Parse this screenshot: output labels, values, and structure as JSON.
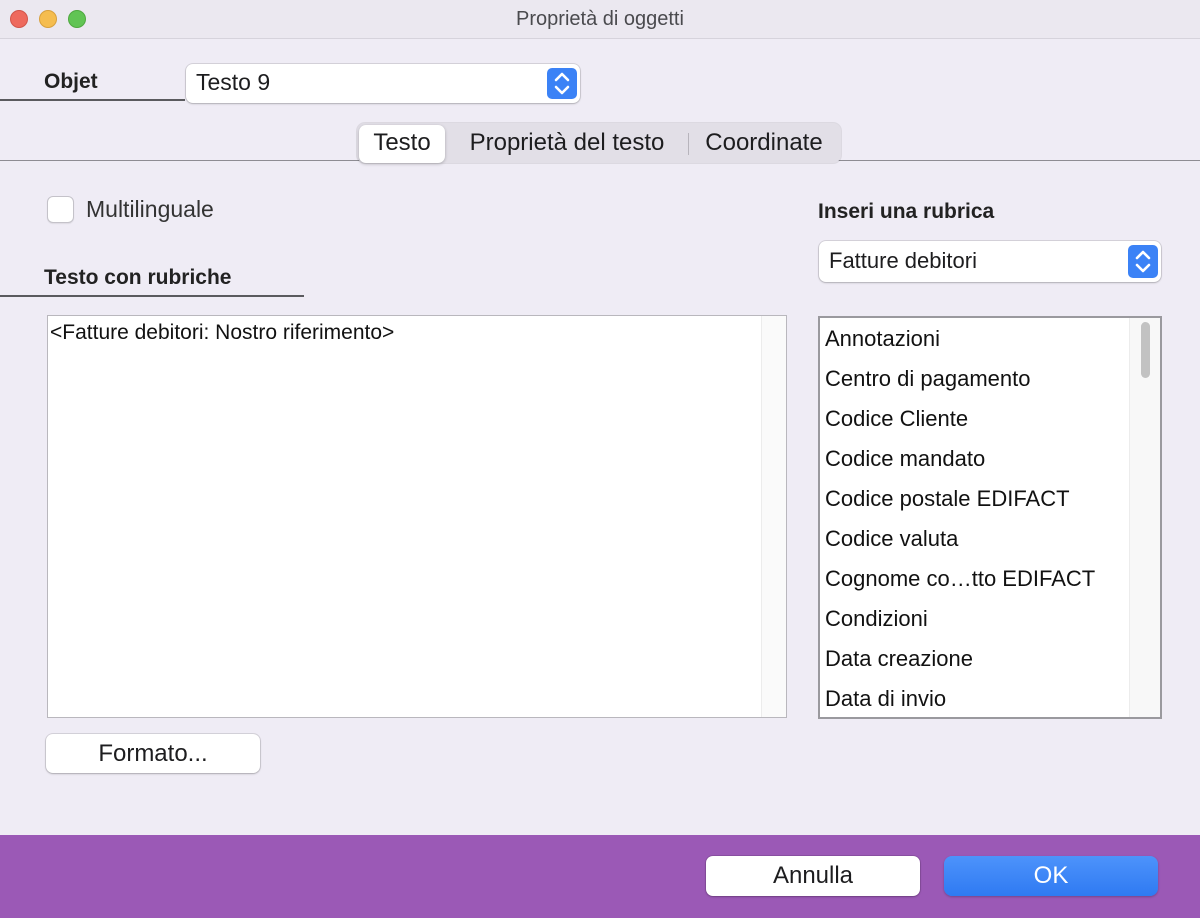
{
  "window": {
    "title": "Proprietà di oggetti"
  },
  "object_selector": {
    "label": "Objet",
    "value": "Testo 9"
  },
  "tabs": [
    {
      "label": "Testo",
      "selected": true
    },
    {
      "label": "Proprietà del testo",
      "selected": false
    },
    {
      "label": "Coordinate",
      "selected": false
    }
  ],
  "multilingual": {
    "label": "Multilinguale",
    "checked": false
  },
  "text_section": {
    "label": "Testo con rubriche",
    "content": "<Fatture debitori: Nostro riferimento>",
    "format_button": "Formato..."
  },
  "insert_rubric": {
    "label": "Inseri una rubrica",
    "selected_source": "Fatture debitori",
    "items": [
      "Annotazioni",
      "Centro di pagamento",
      "Codice Cliente",
      "Codice mandato",
      "Codice postale EDIFACT",
      "Codice valuta",
      "Cognome co…tto EDIFACT",
      "Condizioni",
      "Data creazione",
      "Data di invio"
    ]
  },
  "footer": {
    "cancel_label": "Annulla",
    "ok_label": "OK"
  },
  "colors": {
    "accent": "#2f7af2",
    "footer_background": "#9b59b6",
    "window_background": "#efecf5"
  }
}
